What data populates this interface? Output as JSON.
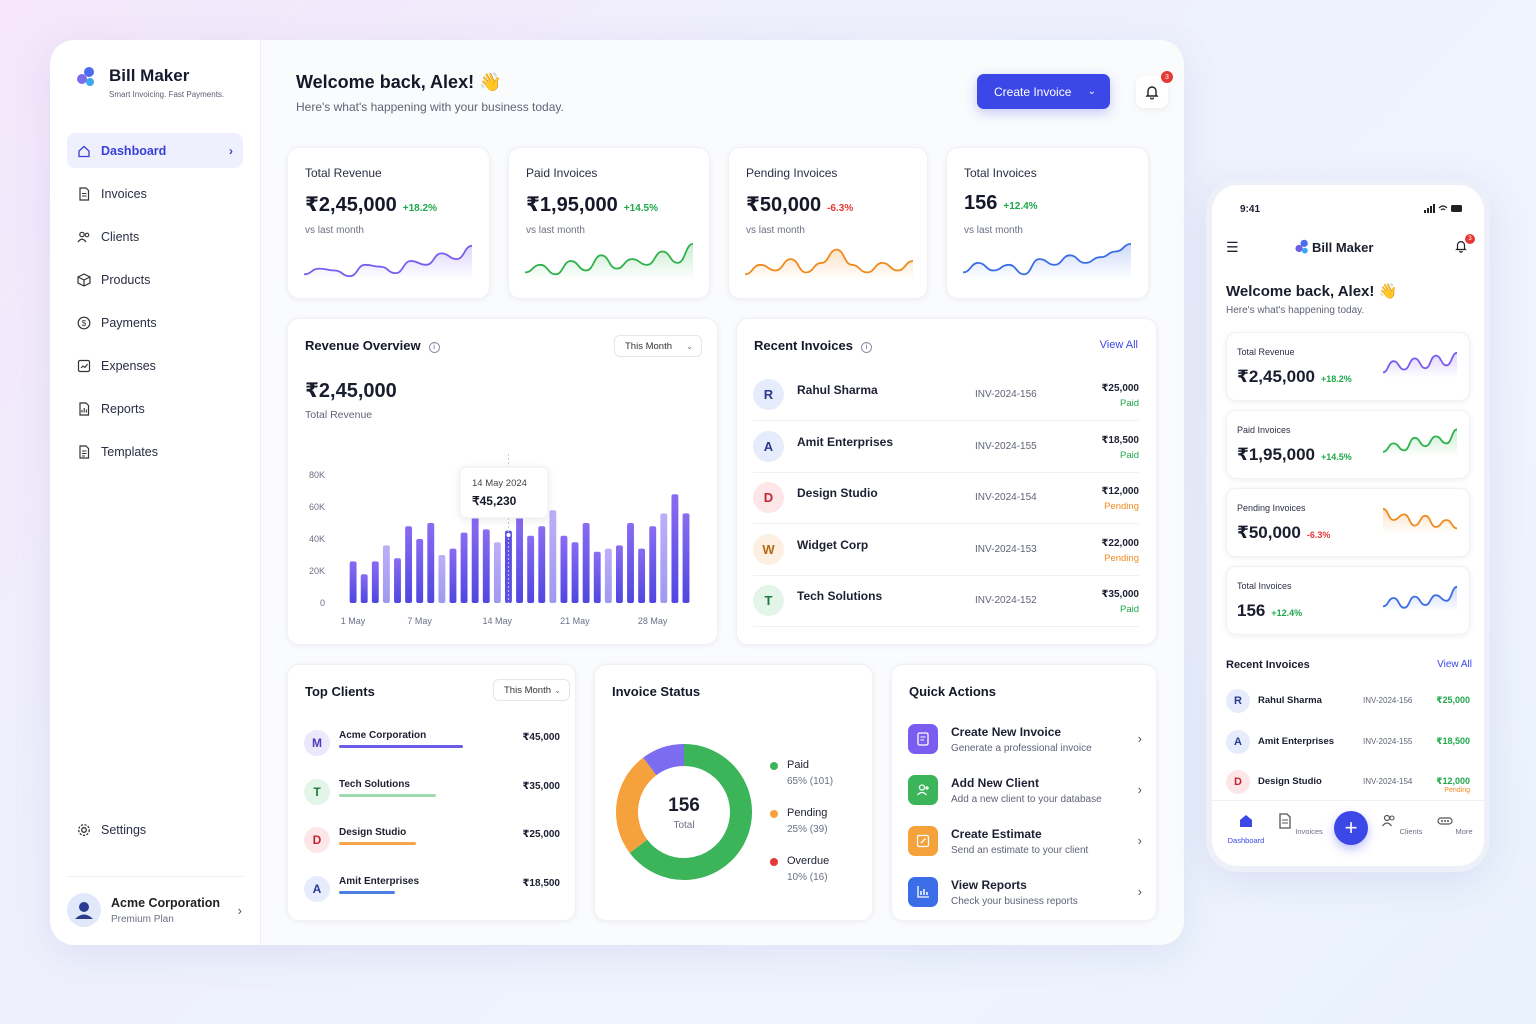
{
  "brand": {
    "name": "Bill Maker",
    "tagline": "Smart Invoicing. Fast Payments."
  },
  "sidebar": {
    "items": [
      {
        "label": "Dashboard",
        "icon": "home-icon",
        "active": true
      },
      {
        "label": "Invoices",
        "icon": "document-icon"
      },
      {
        "label": "Clients",
        "icon": "users-icon"
      },
      {
        "label": "Products",
        "icon": "box-icon"
      },
      {
        "label": "Payments",
        "icon": "dollar-icon"
      },
      {
        "label": "Expenses",
        "icon": "receipt-icon"
      },
      {
        "label": "Reports",
        "icon": "report-icon"
      },
      {
        "label": "Templates",
        "icon": "template-icon"
      }
    ],
    "settings_label": "Settings",
    "profile": {
      "name": "Acme Corporation",
      "plan": "Premium Plan"
    }
  },
  "header": {
    "welcome": "Welcome back, Alex! 👋",
    "subtitle": "Here's what's happening with your business today.",
    "create_button": "Create Invoice",
    "notification_count": "3"
  },
  "stats": [
    {
      "label": "Total Revenue",
      "value": "₹2,45,000",
      "change": "+18.2%",
      "trend": "up",
      "note": "vs last month",
      "color": "#7b5cf0"
    },
    {
      "label": "Paid Invoices",
      "value": "₹1,95,000",
      "change": "+14.5%",
      "trend": "up",
      "note": "vs last month",
      "color": "#2fb24a"
    },
    {
      "label": "Pending Invoices",
      "value": "₹50,000",
      "change": "-6.3%",
      "trend": "down",
      "note": "vs last month",
      "color": "#f08a1d"
    },
    {
      "label": "Total Invoices",
      "value": "156",
      "change": "+12.4%",
      "trend": "up",
      "note": "vs last month",
      "color": "#3b6ee6"
    }
  ],
  "revenue_overview": {
    "title": "Revenue Overview",
    "period": "This Month",
    "total": "₹2,45,000",
    "total_label": "Total Revenue",
    "tooltip": {
      "date": "14 May 2024",
      "value": "₹45,230"
    }
  },
  "chart_data": {
    "type": "bar",
    "ylim": [
      0,
      80000
    ],
    "yticks": [
      "80K",
      "60K",
      "40K",
      "20K",
      "0"
    ],
    "xticks": [
      "1 May",
      "7 May",
      "14 May",
      "21 May",
      "28 May"
    ],
    "categories": [
      "1",
      "2",
      "3",
      "4",
      "5",
      "6",
      "7",
      "8",
      "9",
      "10",
      "11",
      "12",
      "13",
      "14",
      "15",
      "16",
      "17",
      "18",
      "19",
      "20",
      "21",
      "22",
      "23",
      "24",
      "25",
      "26",
      "27",
      "28",
      "29",
      "30",
      "31"
    ],
    "values": [
      26000,
      18000,
      26000,
      36000,
      28000,
      48000,
      40000,
      50000,
      30000,
      34000,
      44000,
      55000,
      46000,
      38000,
      45230,
      54000,
      42000,
      48000,
      58000,
      42000,
      38000,
      50000,
      32000,
      34000,
      36000,
      50000,
      34000,
      48000,
      56000,
      68000,
      56000
    ],
    "highlight_index": 14
  },
  "recent_invoices": {
    "title": "Recent Invoices",
    "view_all": "View All",
    "rows": [
      {
        "initial": "R",
        "name": "Rahul Sharma",
        "id": "INV-2024-156",
        "amount": "₹25,000",
        "status": "Paid",
        "bg": "#e6ecfb",
        "fg": "#2a3b8f"
      },
      {
        "initial": "A",
        "name": "Amit Enterprises",
        "id": "INV-2024-155",
        "amount": "₹18,500",
        "status": "Paid",
        "bg": "#e6ecfb",
        "fg": "#2a3b8f"
      },
      {
        "initial": "D",
        "name": "Design Studio",
        "id": "INV-2024-154",
        "amount": "₹12,000",
        "status": "Pending",
        "bg": "#fde6e8",
        "fg": "#c4242f"
      },
      {
        "initial": "W",
        "name": "Widget Corp",
        "id": "INV-2024-153",
        "amount": "₹22,000",
        "status": "Pending",
        "bg": "#fdf0e2",
        "fg": "#b36a14"
      },
      {
        "initial": "T",
        "name": "Tech Solutions",
        "id": "INV-2024-152",
        "amount": "₹35,000",
        "status": "Paid",
        "bg": "#e3f5e8",
        "fg": "#1d7a3a"
      }
    ]
  },
  "top_clients": {
    "title": "Top Clients",
    "period": "This Month",
    "rows": [
      {
        "initial": "M",
        "name": "Acme Corporation",
        "amount": "₹45,000",
        "share": 1.0,
        "bar": "#6c5ce7",
        "bg": "#ece8fc",
        "fg": "#4a3bbf"
      },
      {
        "initial": "T",
        "name": "Tech Solutions",
        "amount": "₹35,000",
        "share": 0.78,
        "bar": "#9fd9b0",
        "bg": "#e3f5e8",
        "fg": "#1d7a3a"
      },
      {
        "initial": "D",
        "name": "Design Studio",
        "amount": "₹25,000",
        "share": 0.62,
        "bar": "#f5a54a",
        "bg": "#fde6e8",
        "fg": "#c4242f"
      },
      {
        "initial": "A",
        "name": "Amit Enterprises",
        "amount": "₹18,500",
        "share": 0.45,
        "bar": "#4d7fe0",
        "bg": "#e6ecfb",
        "fg": "#2a3b8f"
      }
    ]
  },
  "invoice_status": {
    "title": "Invoice Status",
    "total": "156",
    "total_label": "Total",
    "segments": [
      {
        "name": "Paid",
        "detail": "65% (101)",
        "value": 101,
        "color": "#3cb45a"
      },
      {
        "name": "Pending",
        "detail": "25% (39)",
        "value": 39,
        "color": "#f5a23c"
      },
      {
        "name": "Overdue",
        "detail": "10% (16)",
        "value": 16,
        "color": "#e53935"
      }
    ]
  },
  "quick_actions": {
    "title": "Quick Actions",
    "items": [
      {
        "title": "Create New Invoice",
        "sub": "Generate a professional invoice",
        "color": "#7b5cf0",
        "icon": "invoice-icon"
      },
      {
        "title": "Add New Client",
        "sub": "Add a new client to your database",
        "color": "#3cb45a",
        "icon": "add-user-icon"
      },
      {
        "title": "Create Estimate",
        "sub": "Send an estimate to your client",
        "color": "#f5a23c",
        "icon": "edit-icon"
      },
      {
        "title": "View Reports",
        "sub": "Check your business reports",
        "color": "#3b6ee6",
        "icon": "chart-icon"
      }
    ]
  },
  "phone": {
    "time": "9:41",
    "title": "Bill Maker",
    "notification_count": "3",
    "welcome": "Welcome back, Alex! 👋",
    "subtitle": "Here's what's happening today.",
    "cards": [
      {
        "label": "Total Revenue",
        "value": "₹2,45,000",
        "change": "+18.2%",
        "color": "#7b5cf0"
      },
      {
        "label": "Paid Invoices",
        "value": "₹1,95,000",
        "change": "+14.5%",
        "color": "#2fb24a"
      },
      {
        "label": "Pending Invoices",
        "value": "₹50,000",
        "change": "-6.3%",
        "color": "#f08a1d"
      },
      {
        "label": "Total Invoices",
        "value": "156",
        "change": "+12.4%",
        "color": "#3b6ee6"
      }
    ],
    "recent_title": "Recent Invoices",
    "view_all": "View All",
    "rows": [
      {
        "initial": "R",
        "name": "Rahul Sharma",
        "id": "INV-2024-156",
        "amount": "₹25,000"
      },
      {
        "initial": "A",
        "name": "Amit Enterprises",
        "id": "INV-2024-155",
        "amount": "₹18,500"
      },
      {
        "initial": "D",
        "name": "Design Studio",
        "id": "INV-2024-154",
        "amount": "₹12,000",
        "status": "Pending"
      }
    ],
    "tabs": [
      "Dashboard",
      "Invoices",
      "Clients",
      "More"
    ]
  }
}
